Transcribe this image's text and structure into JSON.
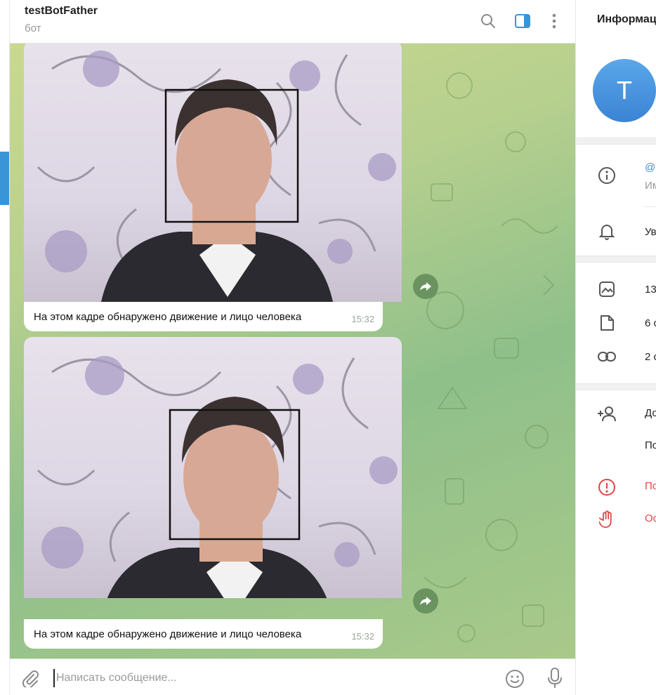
{
  "header": {
    "title": "testBotFather",
    "subtitle": "бот",
    "icons": [
      "search-icon",
      "sidebar-toggle-icon",
      "more-vertical-icon"
    ]
  },
  "messages": [
    {
      "caption": "На этом кадре обнаружено движение и лицо человека",
      "time": "15:32"
    },
    {
      "caption": "На этом кадре обнаружено движение и лицо человека",
      "time": "15:32"
    }
  ],
  "composer": {
    "placeholder": "Написать сообщение...",
    "icons": [
      "paperclip-icon",
      "emoji-icon",
      "microphone-icon"
    ]
  },
  "info_panel": {
    "title": "Информац",
    "avatar_letter": "T",
    "username_prefix": "@",
    "username_label": "Им",
    "notifications": "Ув",
    "media_photos": "13",
    "media_files": "6 с",
    "media_links": "2 с",
    "add_contact": "До",
    "share": "По",
    "report": "По",
    "block": "Ос"
  },
  "colors": {
    "accent": "#3a95d6",
    "danger": "#e04646"
  }
}
